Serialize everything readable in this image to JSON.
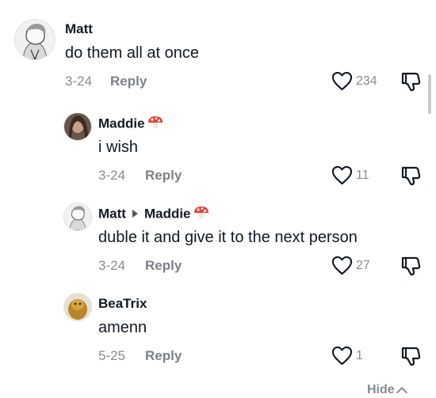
{
  "comments": [
    {
      "author": "Matt",
      "text": "do them all at once",
      "date": "3-24",
      "reply_label": "Reply",
      "likes": "234"
    },
    {
      "author": "Maddie",
      "text": "i wish",
      "date": "3-24",
      "reply_label": "Reply",
      "likes": "11",
      "badge_icon": "mushroom-icon"
    },
    {
      "author": "Matt",
      "replying_to": "Maddie",
      "text": "duble it and give it to the next person",
      "date": "3-24",
      "reply_label": "Reply",
      "likes": "27",
      "badge_icon": "mushroom-icon"
    },
    {
      "author": "BeaTrix",
      "text": "amenn",
      "date": "5-25",
      "reply_label": "Reply",
      "likes": "1"
    }
  ],
  "footer": {
    "hide_label": "Hide"
  },
  "colors": {
    "text": "#161823",
    "muted": "#8a8b91",
    "mushroom_red": "#e8413a"
  }
}
